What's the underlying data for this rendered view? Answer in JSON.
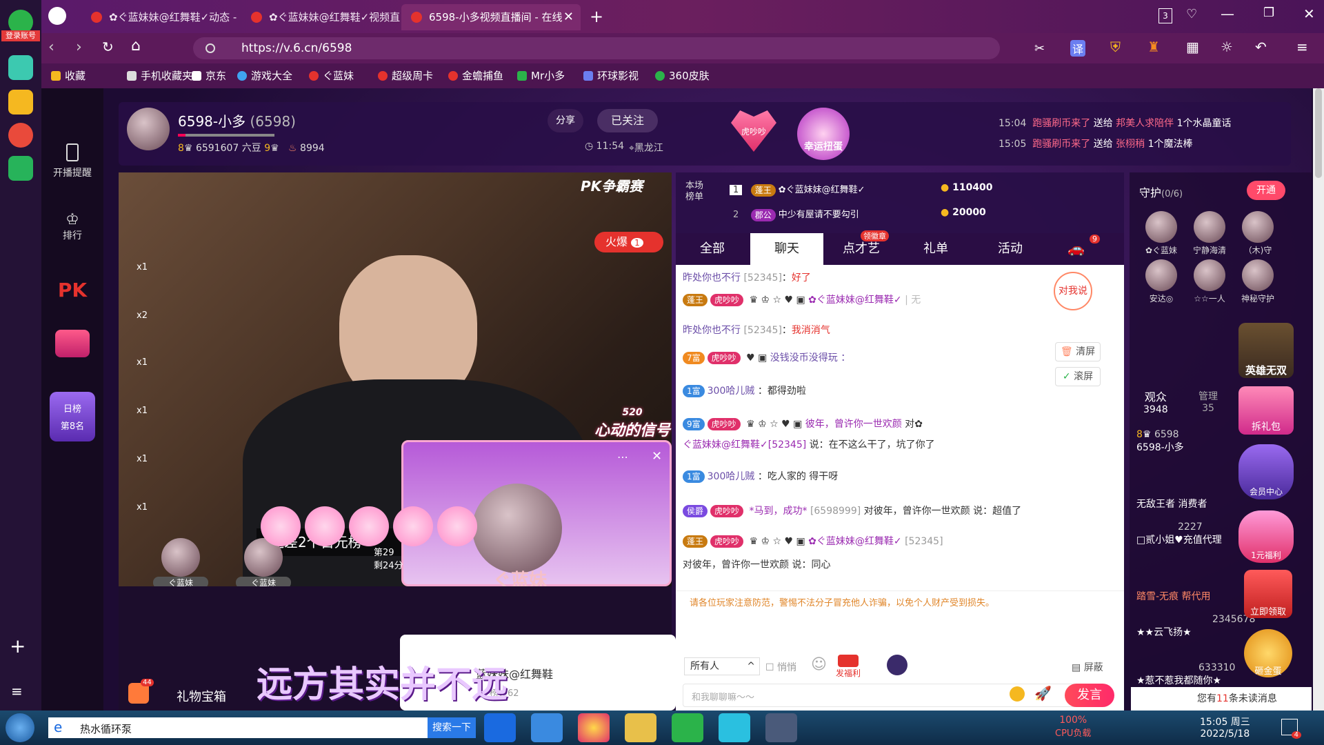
{
  "browser": {
    "tabs": [
      {
        "title": "✿ぐ蓝妹妹@红舞鞋✓动态 - 在"
      },
      {
        "title": "✿ぐ蓝妹妹@红舞鞋✓视频直播"
      },
      {
        "title": "6598-小多视频直播间 - 在线"
      }
    ],
    "tab_count": "3",
    "url": "https://v.6.cn/6598",
    "login_label": "登录账号",
    "bookmarks": [
      "收藏",
      "手机收藏夹",
      "京东",
      "游戏大全",
      "ぐ蓝妹",
      "超级周卡",
      "金蟾捕鱼",
      "Mr小多",
      "环球影视",
      "360皮肤"
    ]
  },
  "site_nav": {
    "items": [
      "开播提醒",
      "排行"
    ],
    "rank_label": "日榜",
    "rank_value": "第8名"
  },
  "anchor": {
    "name": "6598-小多",
    "id": "(6598)",
    "level": "8",
    "beans": "6591607 六豆",
    "level2": "9",
    "fans": "8994",
    "time": "11:54",
    "region": "黑龙江",
    "share": "分享",
    "follow": "已关注"
  },
  "promo": {
    "tiger": "虎吵吵",
    "lucky": "幸运扭蛋"
  },
  "notices": [
    {
      "time": "15:04",
      "user": "跑骚刷币来了",
      "verb": "送给",
      "target": "邦美人求陪伴",
      "gift": "1个水晶童话"
    },
    {
      "time": "15:05",
      "user": "跑骚刷币来了",
      "verb": "送给",
      "target": "张栩稍",
      "gift": "1个魔法棒"
    }
  ],
  "video": {
    "pk_label": "PK争霸赛",
    "hot": "火爆",
    "hot_num": "1",
    "gap": "还差2个百元榜",
    "signal": "心动的信号",
    "signal_num": "520",
    "subtitle": "远方其实并不远",
    "gift_box": "礼物宝箱",
    "gift_box_num": "44",
    "seats": [
      "ぐ蓝妹",
      "ぐ蓝妹"
    ],
    "rank_text": "第29",
    "remain": "剩24分",
    "multipliers": [
      "x1",
      "x2",
      "x1",
      "x1",
      "x1",
      "x1"
    ],
    "popup_title": "ぐ蓝妹",
    "popup_user": "蓝妹妹@红舞鞋",
    "popup_rank": "榜：62"
  },
  "rank_board": {
    "label": "本场榜单",
    "rows": [
      {
        "num": "1",
        "title": "蓬王",
        "name": "✿ぐ蓝妹妹@红舞鞋✓",
        "amount": "110400"
      },
      {
        "num": "2",
        "title": "郡公",
        "name": "中少有屋请不要勾引",
        "amount": "20000"
      }
    ]
  },
  "chat_tabs": [
    "全部",
    "聊天",
    "点才艺",
    "礼单",
    "活动"
  ],
  "chat_tab_badge": "领徽章",
  "chat_car_badge": "9",
  "chat": {
    "lines": [
      {
        "user": "昨处你也不行",
        "id": "[52345]",
        "sep": "：",
        "msg": "好了"
      },
      {
        "user": "✿ぐ蓝妹妹@红舞鞋✓",
        "tail": "| 无"
      },
      {
        "user": "昨处你也不行",
        "id": "[52345]",
        "sep": "：",
        "msg": "我消消气"
      },
      {
        "badge": "7富",
        "tiger": "虎吵吵",
        "text": "没钱没币没得玩 ："
      },
      {
        "badge": "1富",
        "user": "300哈儿贼",
        "msg": "：都得劲啦"
      },
      {
        "badge": "9富",
        "tiger": "虎吵吵",
        "user": "彼年，曾许你一世欢颜",
        "to": "对✿"
      },
      {
        "user": "ぐ蓝妹妹@红舞鞋✓[52345]",
        "msg": "说：在不这么干了，坑了你了"
      },
      {
        "badge": "1富",
        "user": "300哈儿贼",
        "msg": "：吃人家的 得干呀"
      },
      {
        "badge": "侯爵",
        "tiger": "虎吵吵",
        "user": "*马到，成功*",
        "id": "[6598999]",
        "msg": "对彼年，曾许你一世欢颜 说：超值了"
      },
      {
        "user": "✿ぐ蓝妹妹@红舞鞋✓",
        "id": "[52345]"
      },
      {
        "msg": "对彼年，曾许你一世欢颜 说：同心"
      }
    ],
    "warning": "请各位玩家注意防范，警惕不法分子冒充他人诈骗，以免个人财产受到损失。",
    "clear": "清屏",
    "scroll": "滚屏",
    "to_me": "对我说",
    "audience": "所有人",
    "whisper": "悄悄",
    "welfare": "发福利",
    "shield": "屏蔽",
    "placeholder": "和我聊聊嘛～～",
    "send": "发言"
  },
  "right": {
    "guard": "守护",
    "guard_count": "(0/6)",
    "open": "开通",
    "guards": [
      "✿ぐ蓝妹",
      "宁静海清",
      "（木)守",
      "安达◎",
      "☆☆一人",
      "神秘守护"
    ],
    "audience_tab": "观众",
    "audience_num": "3948",
    "admin_tab": "管理",
    "admin_num": "35",
    "users": [
      {
        "lv": "8",
        "num": "6598",
        "name": "6598-小多"
      },
      {
        "name": "无敌王者 消费者"
      },
      {
        "num": "2227",
        "name": "□贰小姐♥充值代理"
      },
      {
        "name": "踏雪-无痕 帮代用"
      },
      {
        "num": "2345678",
        "name": "★★云飞扬★"
      },
      {
        "num": "633310",
        "name": "★惹不惹我都随你★"
      }
    ],
    "promos": [
      "英雄无双",
      "拆礼包",
      "会员中心",
      "1元福利",
      "立即领取",
      "砸金蛋"
    ],
    "unread_pre": "您有",
    "unread_num": "11",
    "unread_post": "条未读消息"
  },
  "taskbar": {
    "search_text": "热水循环泵",
    "search_btn": "搜索一下",
    "cpu": "100%",
    "cpu_label": "CPU负载",
    "time": "15:05 周三",
    "date": "2022/5/18",
    "notif": "4"
  }
}
